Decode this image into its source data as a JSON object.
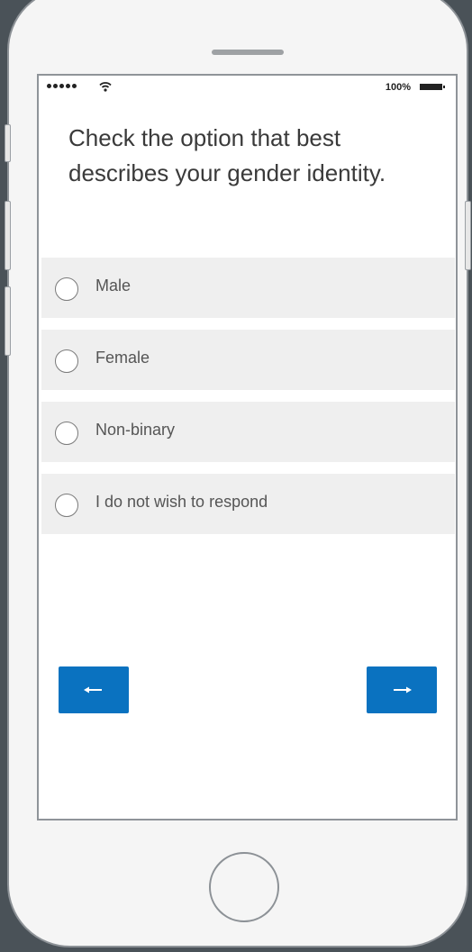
{
  "status_bar": {
    "battery_percent": "100%"
  },
  "question": {
    "text": "Check the option that best describes your gender identity."
  },
  "options": [
    {
      "label": "Male",
      "selected": false
    },
    {
      "label": "Female",
      "selected": false
    },
    {
      "label": "Non-binary",
      "selected": false
    },
    {
      "label": "I do not wish to respond",
      "selected": false
    }
  ],
  "navigation": {
    "back_icon": "arrow-left-icon",
    "next_icon": "arrow-right-icon"
  },
  "colors": {
    "accent": "#0a72c0",
    "option_background": "#efefef",
    "app_background": "#4a5258"
  }
}
